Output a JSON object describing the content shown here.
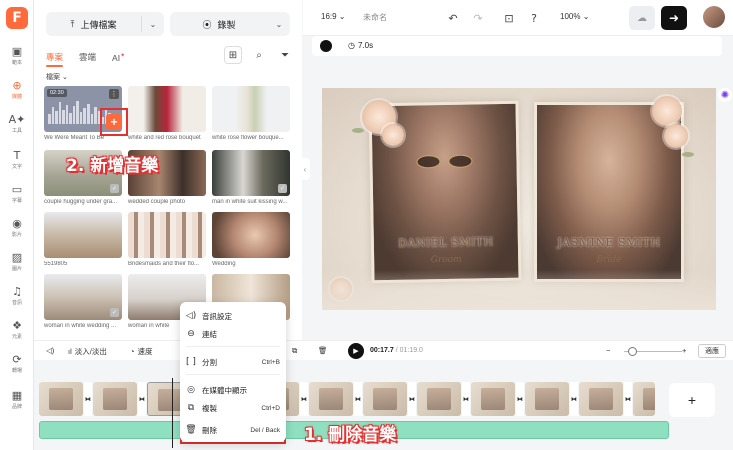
{
  "rail": {
    "logo": "F",
    "items": [
      {
        "icon": "▣",
        "label": "範本"
      },
      {
        "icon": "⊕",
        "label": "媒體"
      },
      {
        "icon": "A✦",
        "label": "工具"
      },
      {
        "icon": "T",
        "label": "文字"
      },
      {
        "icon": "▭",
        "label": "字幕"
      },
      {
        "icon": "◉",
        "label": "影片"
      },
      {
        "icon": "▨",
        "label": "圖片"
      },
      {
        "icon": "♫",
        "label": "音訊"
      },
      {
        "icon": "❖",
        "label": "元素"
      },
      {
        "icon": "⟳",
        "label": "轉場"
      },
      {
        "icon": "▦",
        "label": "品牌"
      }
    ]
  },
  "panel": {
    "upload_label": "上傳檔案",
    "record_label": "錄製",
    "tabs": [
      "專案",
      "雲端",
      "AI"
    ],
    "ai_badge": "✦",
    "filter_label": "檔案",
    "media": [
      {
        "caption": "We Were Meant To Be",
        "duration": "02:30",
        "type": "audio"
      },
      {
        "caption": "white and red rose bouquet"
      },
      {
        "caption": "white rose flower bouque..."
      },
      {
        "caption": "couple hugging under gra..."
      },
      {
        "caption": "wedded couple photo"
      },
      {
        "caption": "man in white suit kissing w..."
      },
      {
        "caption": "5519805"
      },
      {
        "caption": "Bridesmaids and their flo..."
      },
      {
        "caption": "Wedding"
      },
      {
        "caption": "woman in white wedding ..."
      },
      {
        "caption": "woman in white"
      },
      {
        "caption": ""
      }
    ]
  },
  "annotations": {
    "add_music": "2. 新增音樂",
    "delete_music": "1. 刪除音樂"
  },
  "topbar": {
    "ratio": "16:9",
    "project_name": "未命名",
    "zoom": "100%"
  },
  "subbar": {
    "duration": "7.0s"
  },
  "canvas": {
    "groom_name": "DANIEL SMITH",
    "groom_sub": "Groom",
    "bride_name": "JASMINE SMITH",
    "bride_sub": "Bride"
  },
  "timeline": {
    "fade_label": "淡入/淡出",
    "speed_label": "速度",
    "current_time": "00:17.7",
    "total_time": "/ 01:19.0",
    "fit_label": "適應"
  },
  "context_menu": {
    "items": [
      {
        "icon": "◁)",
        "label": "音訊設定",
        "shortcut": ""
      },
      {
        "icon": "⊖",
        "label": "連結",
        "shortcut": ""
      },
      {
        "icon": "[ ]",
        "label": "分割",
        "shortcut": "Ctrl+B"
      },
      {
        "icon": "◎",
        "label": "在媒體中顯示",
        "shortcut": ""
      },
      {
        "icon": "⧉",
        "label": "複製",
        "shortcut": "Ctrl+D"
      },
      {
        "icon": "🗑",
        "label": "刪除",
        "shortcut": "Del / Back"
      }
    ]
  },
  "colors": {
    "accent": "#ff6a3d",
    "annotation_red": "#e53030",
    "audio_track": "#8ee0c0"
  }
}
